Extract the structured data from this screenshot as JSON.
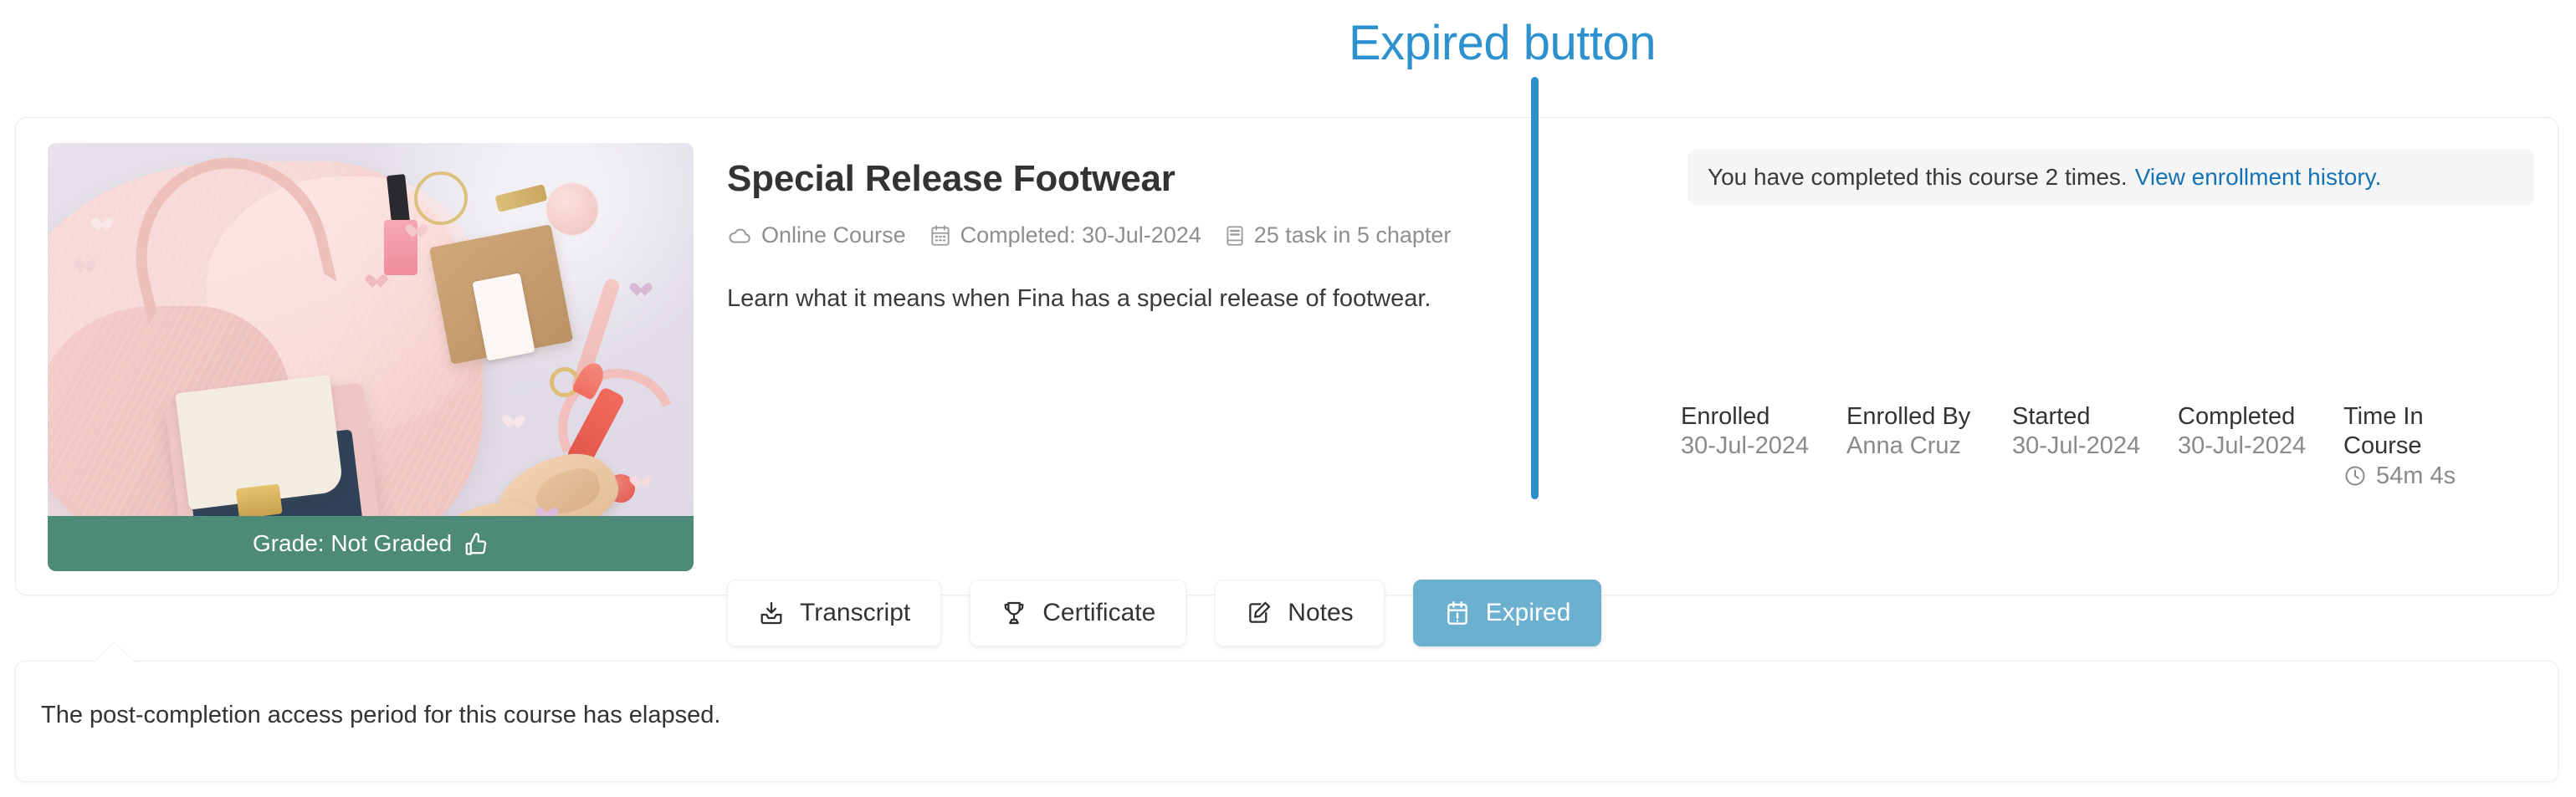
{
  "annotation": {
    "label": "Expired button",
    "color": "#2e91cf",
    "line_color": "#2b8fcb"
  },
  "card": {
    "thumbnail": {
      "alt": "course-thumbnail-flatlay-fashion",
      "grade_text": "Grade: Not Graded",
      "grade_icon": "thumbs-up-icon",
      "grade_bar_color": "#4e8a78"
    },
    "title": "Special Release Footwear",
    "meta": [
      {
        "icon": "cloud-icon",
        "text": "Online Course"
      },
      {
        "icon": "calendar-icon",
        "text": "Completed: 30-Jul-2024"
      },
      {
        "icon": "list-icon",
        "text": "25 task in 5 chapter"
      }
    ],
    "description": "Learn what it means when Fina has a special release of footwear.",
    "buttons": [
      {
        "label": "Transcript",
        "icon": "download-tray-icon",
        "primary": false
      },
      {
        "label": "Certificate",
        "icon": "trophy-icon",
        "primary": false
      },
      {
        "label": "Notes",
        "icon": "edit-note-icon",
        "primary": false
      },
      {
        "label": "Expired",
        "icon": "calendar-alert-icon",
        "primary": true
      }
    ],
    "notice": {
      "text": "You have completed this course 2 times.",
      "link": "View enrollment history.",
      "link_color": "#1573b5"
    },
    "stats": [
      {
        "label": "Enrolled",
        "value": "30-Jul-2024",
        "icon": ""
      },
      {
        "label": "Enrolled By",
        "value": "Anna Cruz",
        "icon": ""
      },
      {
        "label": "Started",
        "value": "30-Jul-2024",
        "icon": ""
      },
      {
        "label": "Completed",
        "value": "30-Jul-2024",
        "icon": ""
      },
      {
        "label": "Time In Course",
        "value": "54m 4s",
        "icon": "clock-icon"
      }
    ]
  },
  "callout": {
    "text": "The post-completion access period for this course has elapsed."
  }
}
